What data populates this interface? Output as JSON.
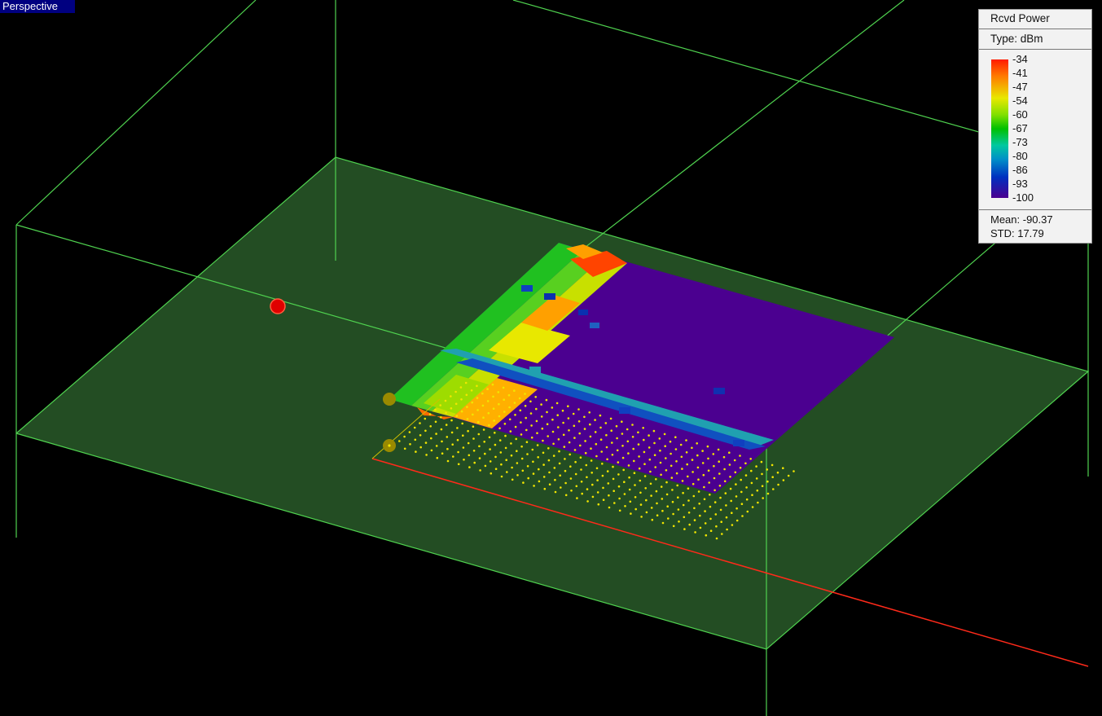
{
  "view": {
    "label": "Perspective"
  },
  "legend": {
    "title": "Rcvd Power",
    "type": "Type: dBm",
    "ticks": [
      "-34",
      "-41",
      "-47",
      "-54",
      "-60",
      "-67",
      "-73",
      "-80",
      "-86",
      "-93",
      "-100"
    ],
    "mean": "Mean: -90.37",
    "std": "STD: 17.79"
  },
  "colors": {
    "background": "#000000",
    "wireframe": "#4fd24f",
    "floor": "#234d23",
    "low_power": "#4b0090",
    "receiver_points": "#f2e600",
    "x_axis": "#ff2a1a"
  }
}
